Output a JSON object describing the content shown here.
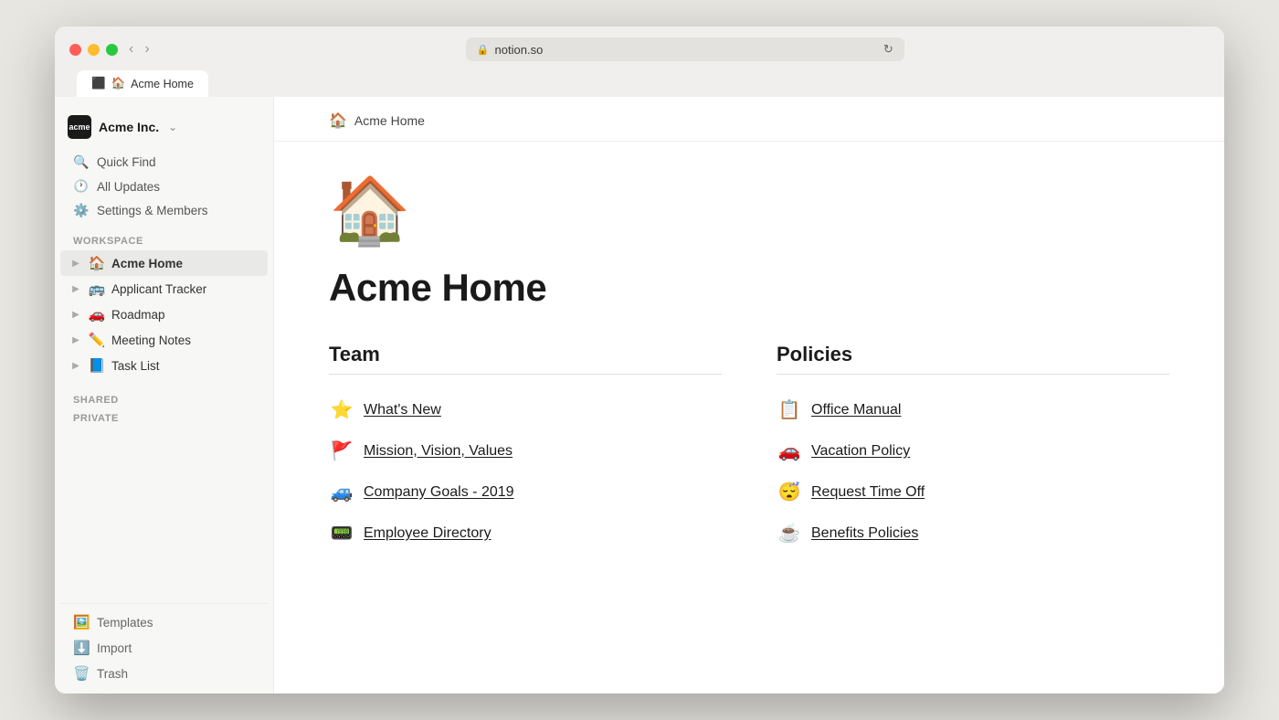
{
  "browser": {
    "url": "notion.so",
    "tab_label": "Acme Home",
    "tab_notion_icon": "N",
    "tab_page_emoji": "🏠",
    "back_btn": "‹",
    "forward_btn": "›"
  },
  "workspace": {
    "name": "Acme Inc.",
    "logo_text": "acme"
  },
  "sidebar": {
    "nav_items": [
      {
        "id": "quick-find",
        "icon": "🔍",
        "label": "Quick Find"
      },
      {
        "id": "all-updates",
        "icon": "🕐",
        "label": "All Updates"
      },
      {
        "id": "settings",
        "icon": "⚙️",
        "label": "Settings & Members"
      }
    ],
    "section_workspace": "WORKSPACE",
    "workspace_pages": [
      {
        "id": "acme-home",
        "emoji": "🏠",
        "label": "Acme Home",
        "active": true
      },
      {
        "id": "applicant-tracker",
        "emoji": "🚌",
        "label": "Applicant Tracker",
        "active": false
      },
      {
        "id": "roadmap",
        "emoji": "🚗",
        "label": "Roadmap",
        "active": false
      },
      {
        "id": "meeting-notes",
        "emoji": "✏️",
        "label": "Meeting Notes",
        "active": false
      },
      {
        "id": "task-list",
        "emoji": "📘",
        "label": "Task List",
        "active": false
      }
    ],
    "section_shared": "SHARED",
    "section_private": "PRIVATE",
    "bottom_items": [
      {
        "id": "templates",
        "icon": "🖼️",
        "label": "Templates"
      },
      {
        "id": "import",
        "icon": "⬇️",
        "label": "Import"
      },
      {
        "id": "trash",
        "icon": "🗑️",
        "label": "Trash"
      }
    ]
  },
  "page": {
    "header_emoji": "🏠",
    "header_title": "Acme Home",
    "icon": "🏠",
    "title": "Acme Home",
    "team_section": {
      "heading": "Team",
      "links": [
        {
          "emoji": "⭐",
          "label": "What's New"
        },
        {
          "emoji": "🚩",
          "label": "Mission, Vision, Values"
        },
        {
          "emoji": "🚙",
          "label": "Company Goals - 2019"
        },
        {
          "emoji": "📟",
          "label": "Employee Directory"
        }
      ]
    },
    "policies_section": {
      "heading": "Policies",
      "links": [
        {
          "emoji": "📋",
          "label": "Office Manual"
        },
        {
          "emoji": "🚗",
          "label": "Vacation Policy"
        },
        {
          "emoji": "😴",
          "label": "Request Time Off"
        },
        {
          "emoji": "☕",
          "label": "Benefits Policies"
        }
      ]
    }
  }
}
